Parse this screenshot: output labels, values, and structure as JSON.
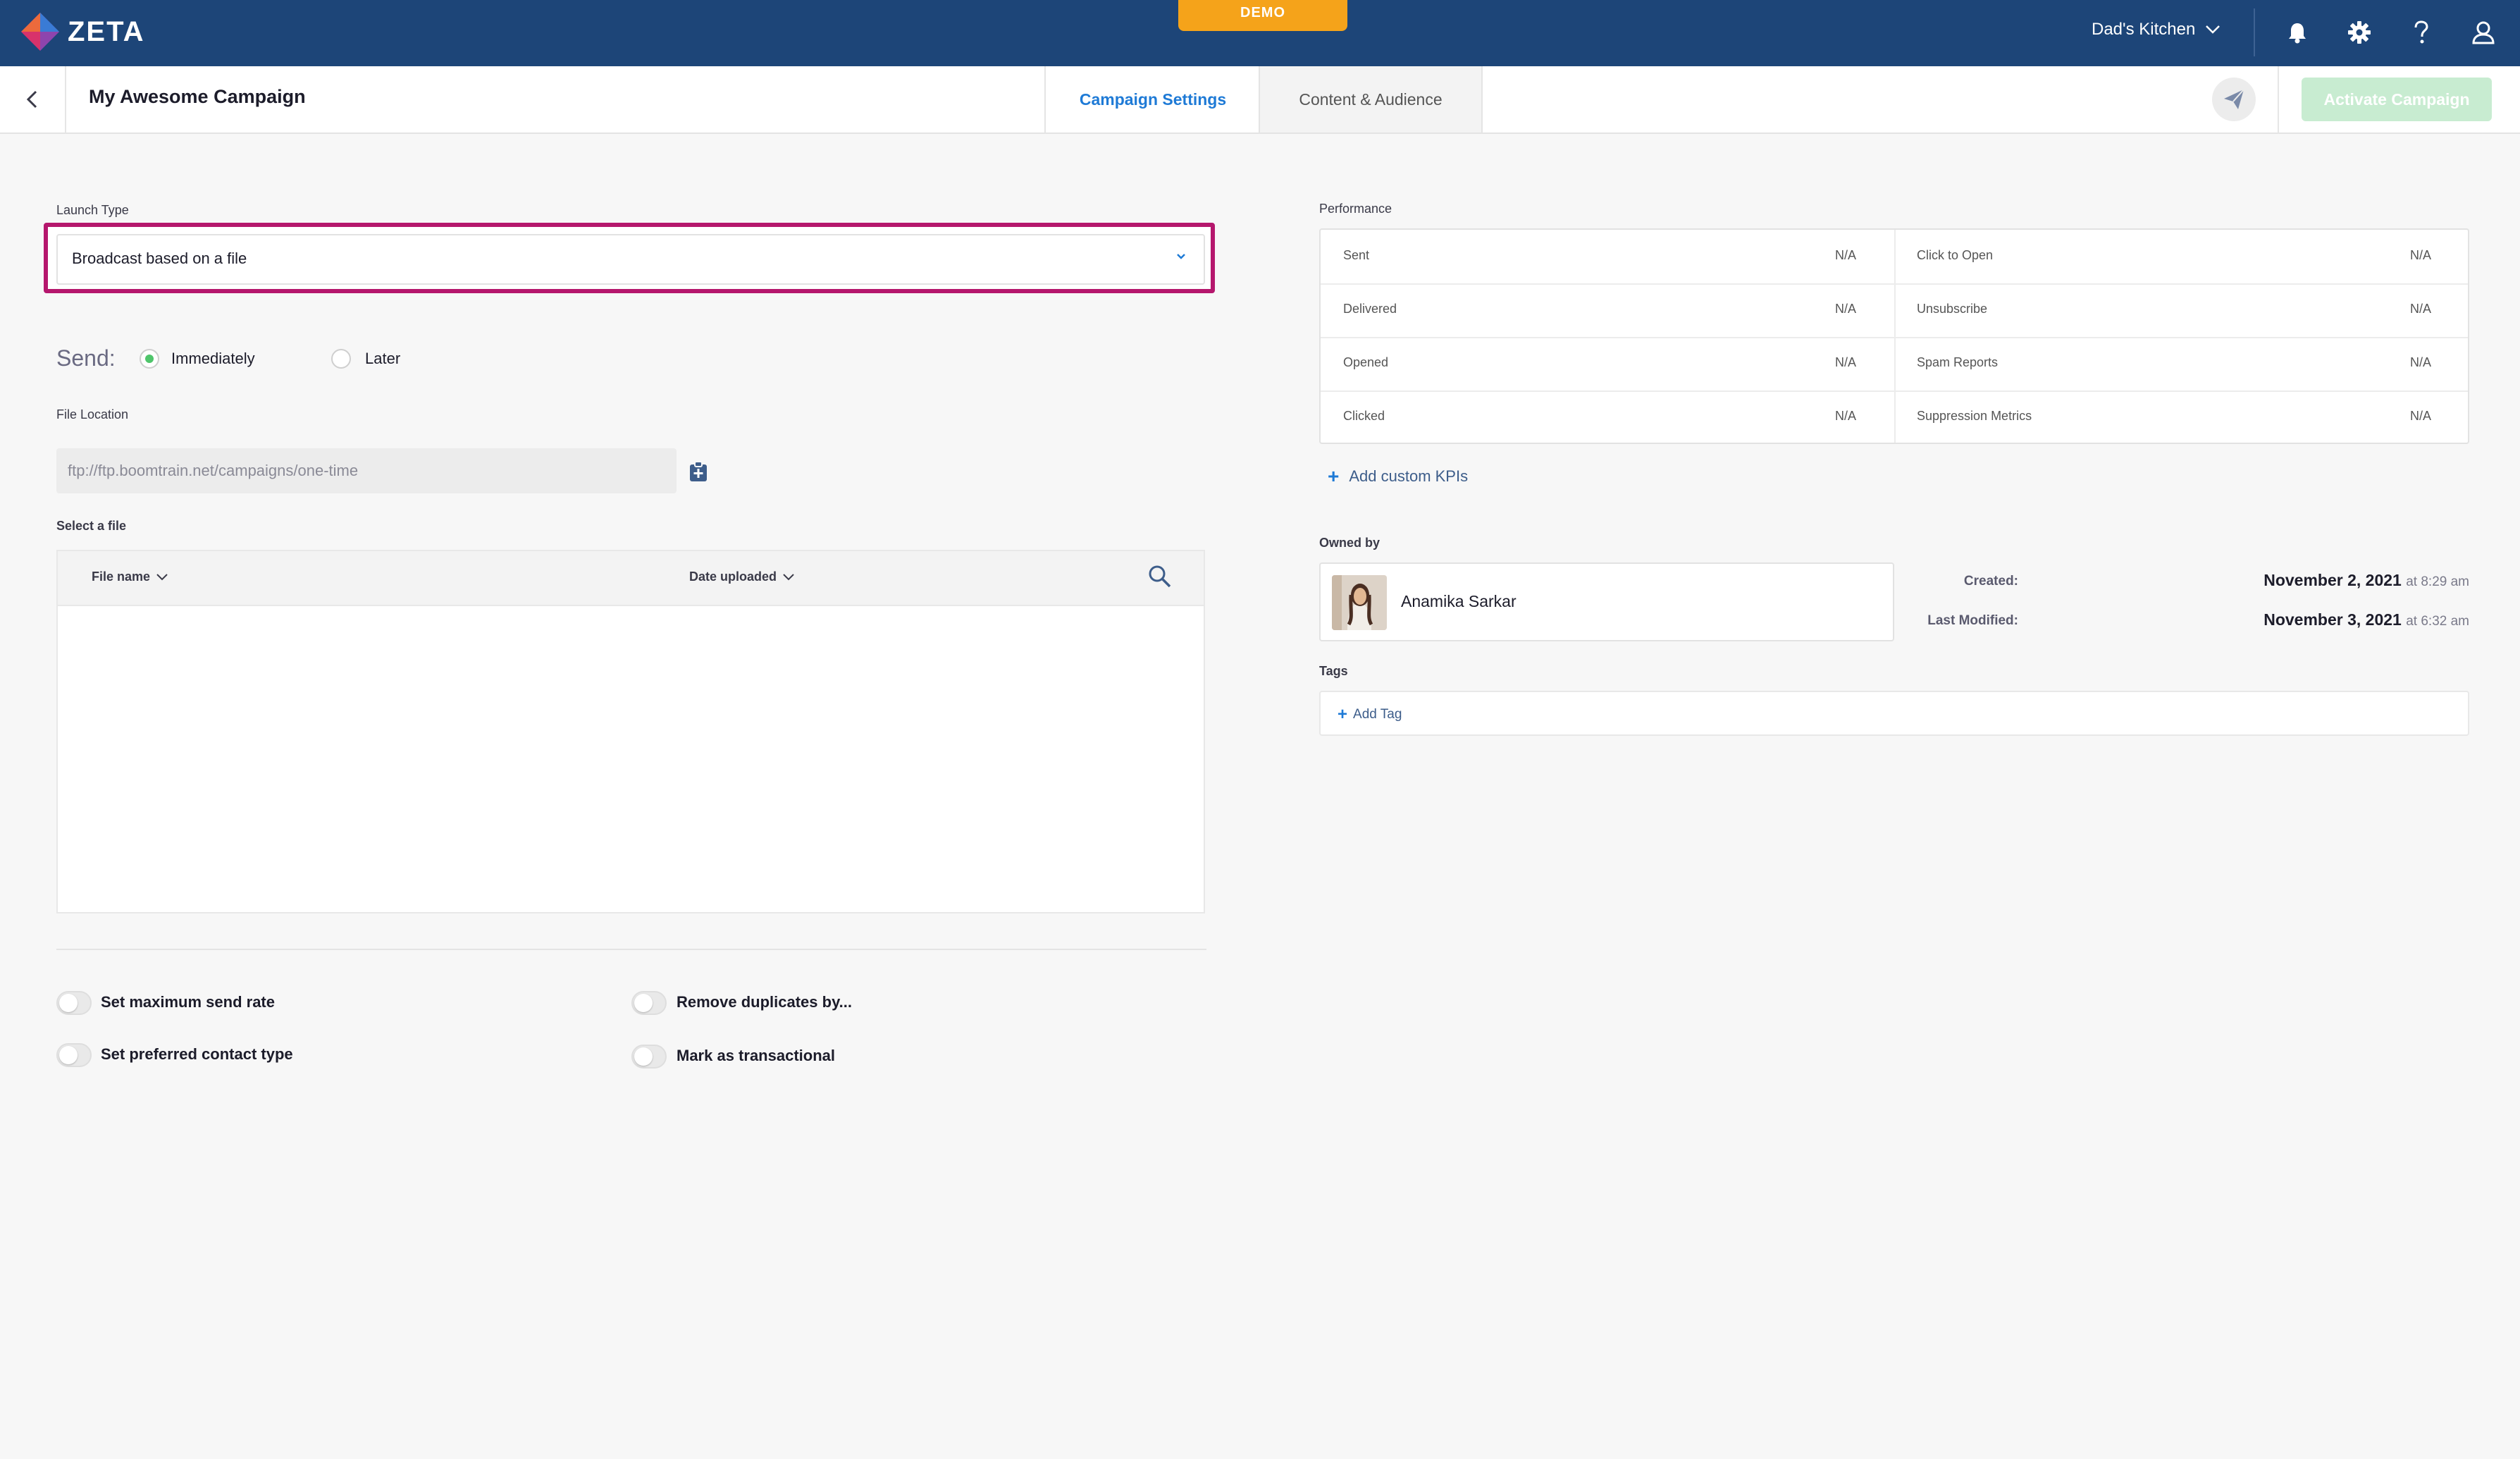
{
  "app": {
    "brand": "ZETA",
    "demo_badge": "DEMO",
    "account_name": "Dad's Kitchen"
  },
  "header": {
    "campaign_title": "My Awesome Campaign",
    "tabs": [
      {
        "label": "Campaign Settings",
        "active": true
      },
      {
        "label": "Content & Audience",
        "active": false
      }
    ],
    "activate_label": "Activate Campaign"
  },
  "settings": {
    "launch_type_label": "Launch Type",
    "launch_type_value": "Broadcast based on a file",
    "send_label": "Send:",
    "send_options": [
      {
        "label": "Immediately",
        "selected": true
      },
      {
        "label": "Later",
        "selected": false
      }
    ],
    "file_location_label": "File Location",
    "file_location_value": "ftp://ftp.boomtrain.net/campaigns/one-time",
    "select_file_label": "Select a file",
    "file_table": {
      "columns": [
        "File name",
        "Date uploaded"
      ],
      "rows": []
    },
    "toggles": [
      {
        "label": "Set maximum send rate",
        "on": false
      },
      {
        "label": "Remove duplicates by...",
        "on": false
      },
      {
        "label": "Set preferred contact type",
        "on": false
      },
      {
        "label": "Mark as transactional",
        "on": false
      }
    ]
  },
  "performance": {
    "label": "Performance",
    "rows": [
      {
        "left_name": "Sent",
        "left_value": "N/A",
        "right_name": "Click to Open",
        "right_value": "N/A"
      },
      {
        "left_name": "Delivered",
        "left_value": "N/A",
        "right_name": "Unsubscribe",
        "right_value": "N/A"
      },
      {
        "left_name": "Opened",
        "left_value": "N/A",
        "right_name": "Spam Reports",
        "right_value": "N/A"
      },
      {
        "left_name": "Clicked",
        "left_value": "N/A",
        "right_name": "Suppression Metrics",
        "right_value": "N/A"
      }
    ],
    "add_kpi_label": "Add custom KPIs"
  },
  "ownership": {
    "owned_by_label": "Owned by",
    "owner_name": "Anamika Sarkar",
    "created_label": "Created:",
    "created_date": "November 2, 2021",
    "created_time": "at 8:29 am",
    "modified_label": "Last Modified:",
    "modified_date": "November 3, 2021",
    "modified_time": "at 6:32 am"
  },
  "tags": {
    "label": "Tags",
    "add_label": "Add Tag"
  },
  "colors": {
    "topbar": "#1d4578",
    "accent": "#1e7ad6",
    "highlight_border": "#b5176d",
    "demo_badge": "#f5a31a",
    "radio_selected": "#4fc56b",
    "activate_disabled": "#c8ecd1"
  },
  "icons": {
    "logo": "zeta-diamond-logo",
    "notifications": "bell-icon",
    "settings": "gear-icon",
    "help": "question-icon",
    "profile": "user-icon",
    "back": "chevron-left-icon",
    "send_test": "paper-plane-icon",
    "clipboard": "clipboard-plus-icon",
    "search": "search-icon"
  }
}
